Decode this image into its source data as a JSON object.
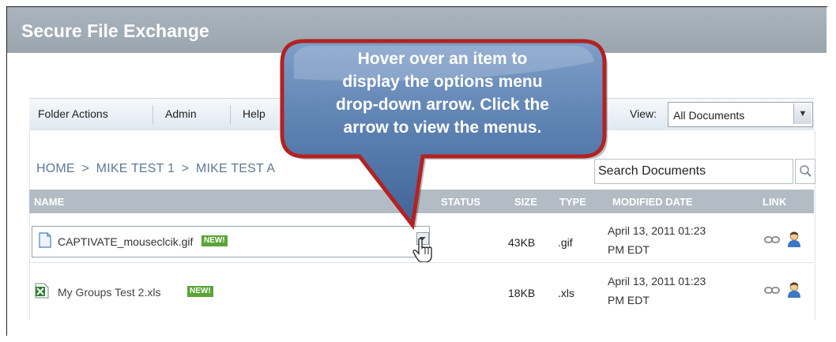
{
  "app": {
    "title": "Secure File Exchange"
  },
  "toolbar": {
    "items": [
      "Folder Actions",
      "Admin",
      "Help"
    ],
    "view_label": "View:",
    "view_value": "All Documents"
  },
  "breadcrumb": [
    "HOME",
    ">",
    "MIKE TEST 1",
    ">",
    "MIKE TEST A"
  ],
  "search": {
    "placeholder": "Search Documents"
  },
  "table": {
    "headers": [
      "NAME",
      "STATUS",
      "SIZE",
      "TYPE",
      "MODIFIED DATE",
      "LINK"
    ],
    "rows": [
      {
        "name": "CAPTIVATE_mouseclcik.gif",
        "badge": "NEW!",
        "size": "43KB",
        "type": ".gif",
        "modified_line1": "April 13, 2011 01:23",
        "modified_line2": "PM EDT",
        "icon": "document-icon"
      },
      {
        "name": "My Groups Test 2.xls",
        "badge": "NEW!",
        "size": "18KB",
        "type": ".xls",
        "modified_line1": "April 13, 2011 01:23",
        "modified_line2": "PM EDT",
        "icon": "excel-file-icon"
      }
    ]
  },
  "callout": {
    "lines": [
      "Hover over an item to",
      "display  the options menu",
      "drop-down arrow. Click the",
      "arrow to view the menus."
    ]
  },
  "colors": {
    "titlebar": "#9aa5ae",
    "header": "#b3bcc5",
    "badge": "#5aa437",
    "callout_fill": "#5b7fae",
    "callout_border": "#b22222"
  }
}
